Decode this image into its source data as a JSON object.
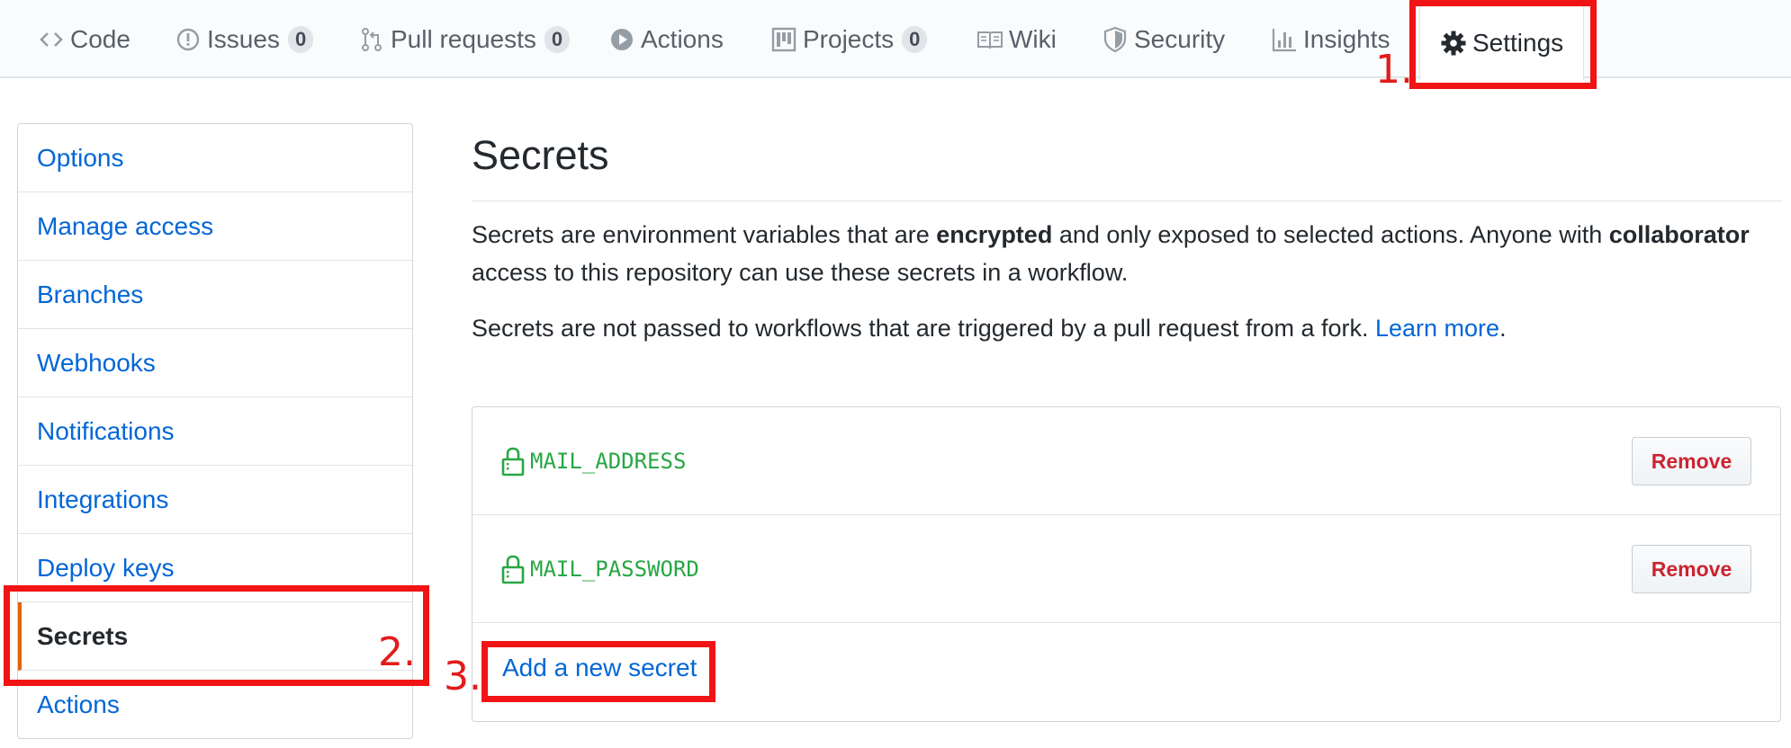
{
  "tabs": [
    {
      "label": "Code",
      "icon": "code-icon"
    },
    {
      "label": "Issues",
      "icon": "issue-icon",
      "count": "0"
    },
    {
      "label": "Pull requests",
      "icon": "pull-request-icon",
      "count": "0"
    },
    {
      "label": "Actions",
      "icon": "play-icon"
    },
    {
      "label": "Projects",
      "icon": "project-icon",
      "count": "0"
    },
    {
      "label": "Wiki",
      "icon": "book-icon"
    },
    {
      "label": "Security",
      "icon": "shield-icon"
    },
    {
      "label": "Insights",
      "icon": "graph-icon"
    },
    {
      "label": "Settings",
      "icon": "gear-icon",
      "selected": true
    }
  ],
  "sidebar": {
    "items": [
      {
        "label": "Options"
      },
      {
        "label": "Manage access"
      },
      {
        "label": "Branches"
      },
      {
        "label": "Webhooks"
      },
      {
        "label": "Notifications"
      },
      {
        "label": "Integrations"
      },
      {
        "label": "Deploy keys"
      },
      {
        "label": "Secrets",
        "selected": true
      },
      {
        "label": "Actions"
      }
    ]
  },
  "main": {
    "title": "Secrets",
    "para1": {
      "t1": "Secrets are environment variables that are ",
      "b1": "encrypted",
      "t2": " and only exposed to selected actions. Anyone with ",
      "b2": "collaborator",
      "t3": " access to this repository can use these secrets in a workflow."
    },
    "para2": {
      "text": "Secrets are not passed to workflows that are triggered by a pull request from a fork. ",
      "link": "Learn more",
      "end": "."
    },
    "secrets": [
      {
        "name": "MAIL_ADDRESS",
        "button": "Remove"
      },
      {
        "name": "MAIL_PASSWORD",
        "button": "Remove"
      }
    ],
    "add_link": "Add a new secret"
  },
  "annotations": {
    "step1": "1.",
    "step2": "2.",
    "step3": "3.",
    "color": "#f01414"
  },
  "colors": {
    "link": "#0366d6",
    "accent": "#e36209",
    "secret_name": "#28a745",
    "danger": "#cb2431"
  }
}
